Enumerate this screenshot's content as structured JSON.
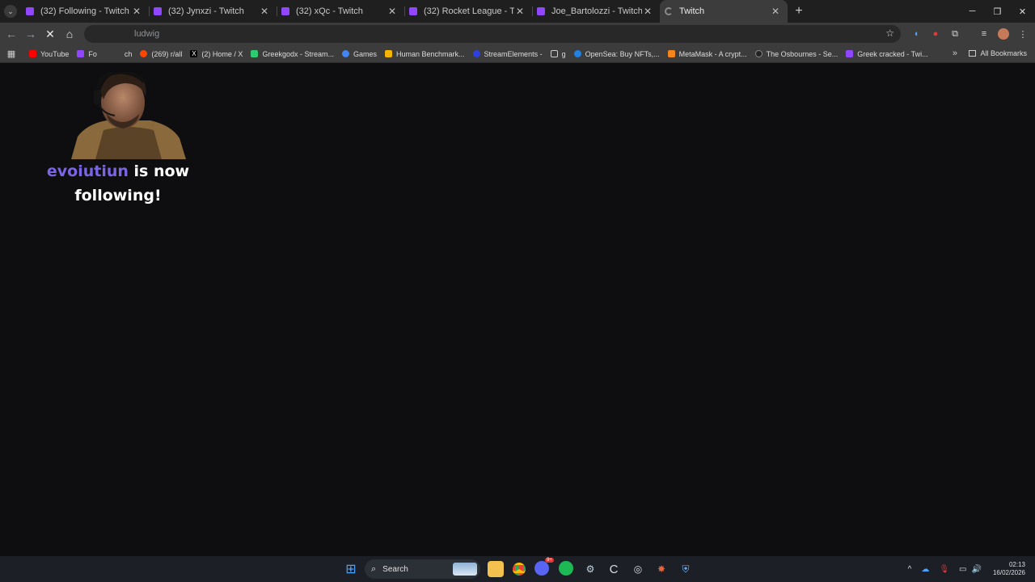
{
  "browser": {
    "tabs": [
      {
        "title": "(32) Following - Twitch",
        "favicon": "twitch-icon"
      },
      {
        "title": "(32) Jynxzi - Twitch",
        "favicon": "twitch-icon"
      },
      {
        "title": "(32) xQc - Twitch",
        "favicon": "twitch-icon"
      },
      {
        "title": "(32) Rocket League - Twitch",
        "favicon": "twitch-icon"
      },
      {
        "title": "Joe_Bartolozzi - Twitch",
        "favicon": "twitch-icon"
      },
      {
        "title": "Twitch",
        "favicon": "loading-icon",
        "active": true
      }
    ],
    "address": "ludwig",
    "bookmarks": [
      "YouTube",
      "Fo",
      "ch",
      "(269) r/all",
      "(2) Home / X",
      "Greekgodx - Stream...",
      "Games",
      "Human Benchmark...",
      "StreamElements -",
      "g",
      "OpenSea: Buy NFTs,...",
      "MetaMask - A crypt...",
      "The Osbournes - Se...",
      "Greek cracked - Twi..."
    ],
    "all_bookmarks": "All Bookmarks"
  },
  "alert": {
    "username": "evoiutiun",
    "message_line1": " is now",
    "message_line2": "following!"
  },
  "taskbar": {
    "search_label": "Search",
    "time": "02:13",
    "date": "16/02/2026",
    "discord_badge": "9+"
  },
  "colors": {
    "twitch_purple": "#9146ff",
    "alert_username": "#7b65e6",
    "page_background": "#0e0e10"
  }
}
